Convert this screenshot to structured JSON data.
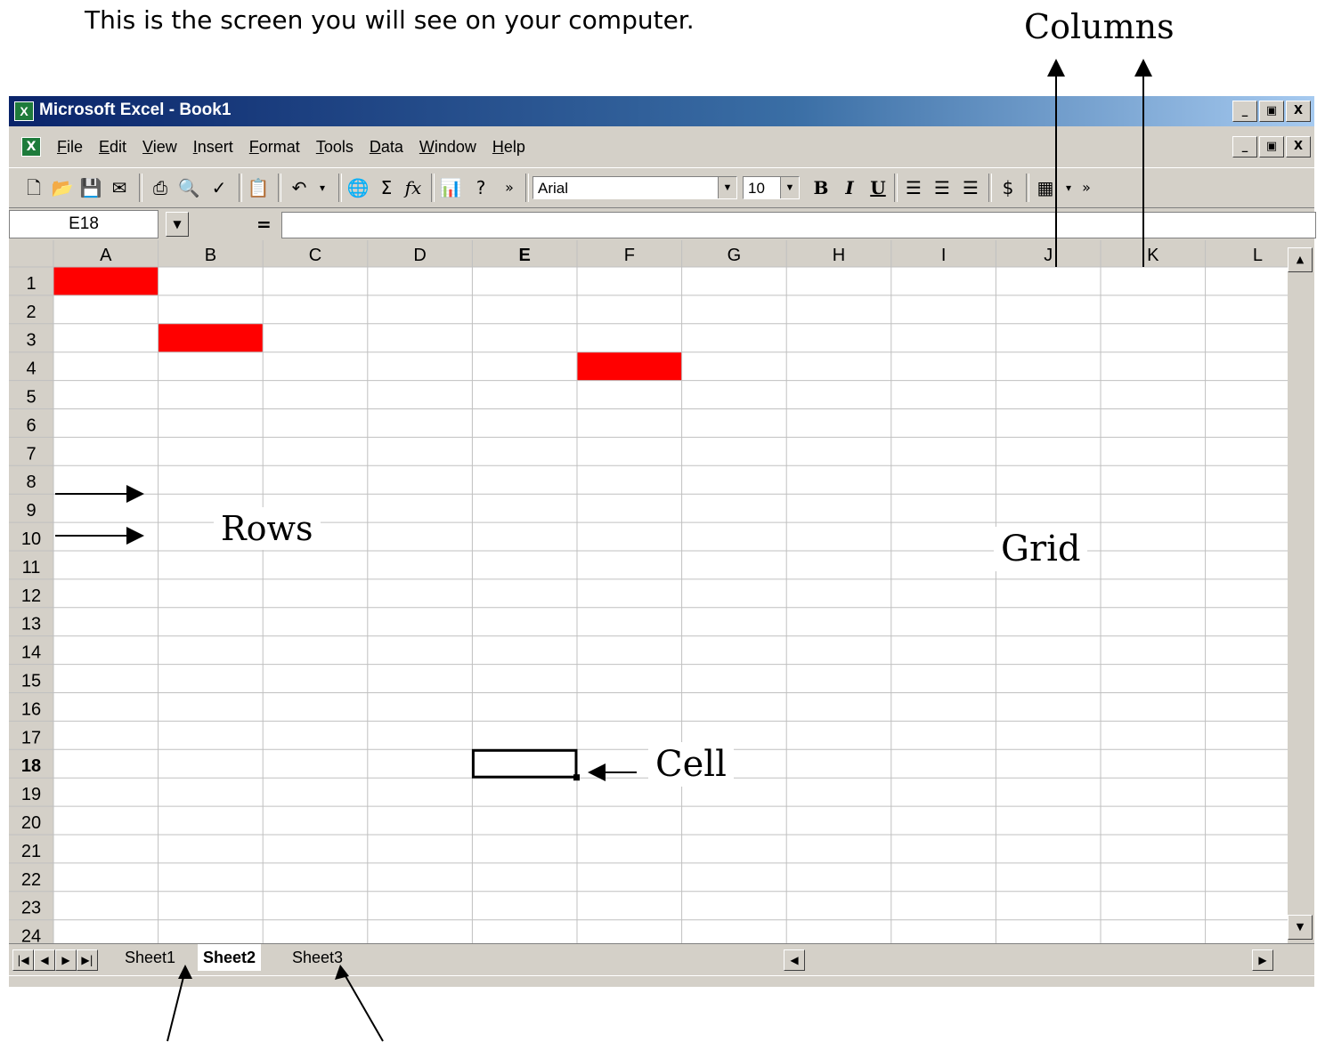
{
  "heading": "This is the screen you will see on your computer.",
  "window": {
    "title": "Microsoft Excel - Book1",
    "minimize": "_",
    "restore": "▣",
    "close": "X"
  },
  "menu": {
    "items": [
      "File",
      "Edit",
      "View",
      "Insert",
      "Format",
      "Tools",
      "Data",
      "Window",
      "Help"
    ]
  },
  "toolbar": {
    "font_name": "Arial",
    "font_size": "10",
    "bold_label": "B",
    "italic_label": "I",
    "underline_label": "U",
    "more_label": "»"
  },
  "formula_bar": {
    "name_box": "E18",
    "equals_label": "=",
    "formula": ""
  },
  "sheet": {
    "columns": [
      "A",
      "B",
      "C",
      "D",
      "E",
      "F",
      "G",
      "H",
      "I",
      "J",
      "K",
      "L"
    ],
    "rows": [
      "1",
      "2",
      "3",
      "4",
      "5",
      "6",
      "7",
      "8",
      "9",
      "10",
      "11",
      "12",
      "13",
      "14",
      "15",
      "16",
      "17",
      "18",
      "19",
      "20",
      "21",
      "22",
      "23",
      "24"
    ],
    "active_cell": "E18",
    "active_column": "E",
    "active_row": "18",
    "filled_cells": [
      "A1",
      "B3",
      "F4"
    ],
    "fill_color": "#ff0000",
    "gridline_color": "#c0c0c0"
  },
  "tabs": {
    "sheets": [
      "Sheet1",
      "Sheet2",
      "Sheet3"
    ],
    "active": "Sheet2"
  },
  "annotations": {
    "columns": "Columns",
    "rows": "Rows",
    "grid": "Grid",
    "cell": "Cell"
  }
}
